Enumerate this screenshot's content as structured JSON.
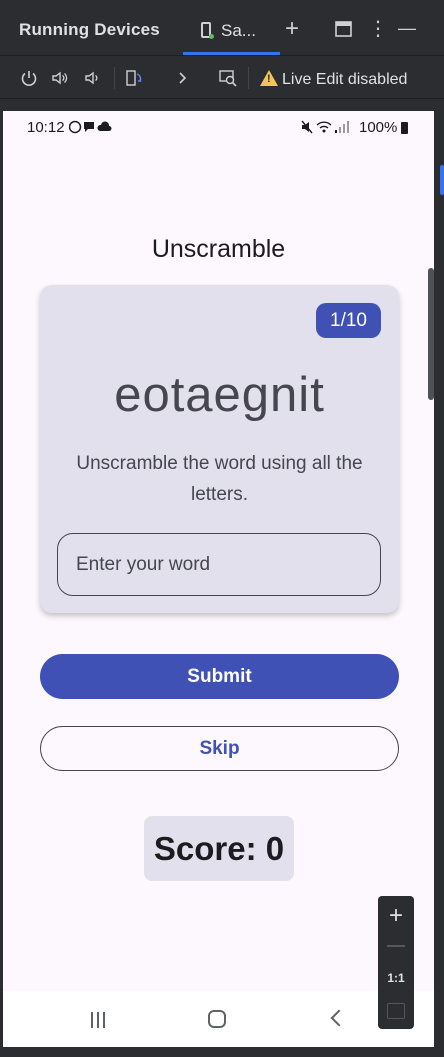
{
  "ide": {
    "title": "Running Devices",
    "tab_label": "Sa...",
    "new_tab_glyph": "+",
    "more_glyph": "⋮",
    "minimize_glyph": "—",
    "live_edit": "Live Edit disabled",
    "tab_accent_color": "#3574f0",
    "warning_color": "#f2c55c"
  },
  "status_bar": {
    "time": "10:12",
    "battery": "100%"
  },
  "app": {
    "title": "Unscramble",
    "counter": "1/10",
    "scrambled_word": "eotaegnit",
    "instructions": "Unscramble the word using all the letters.",
    "input_placeholder": "Enter your word",
    "input_value": "",
    "submit_label": "Submit",
    "skip_label": "Skip",
    "score": "Score: 0",
    "primary_color": "#3f51b5",
    "card_color": "#e2e0ec"
  },
  "zoom_controls": {
    "zoom_in_glyph": "+",
    "actual_size_label": "1:1"
  }
}
